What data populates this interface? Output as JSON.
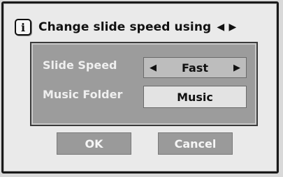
{
  "header": {
    "info_icon_glyph": "i",
    "title": "Change slide speed using",
    "title_arrows": "◀ ▶"
  },
  "settings": {
    "slide_speed_label": "Slide Speed",
    "slide_speed_value": "Fast",
    "left_arrow": "◀",
    "right_arrow": "▶",
    "music_folder_label": "Music Folder",
    "music_folder_value": "Music"
  },
  "buttons": {
    "ok_label": "OK",
    "cancel_label": "Cancel"
  }
}
